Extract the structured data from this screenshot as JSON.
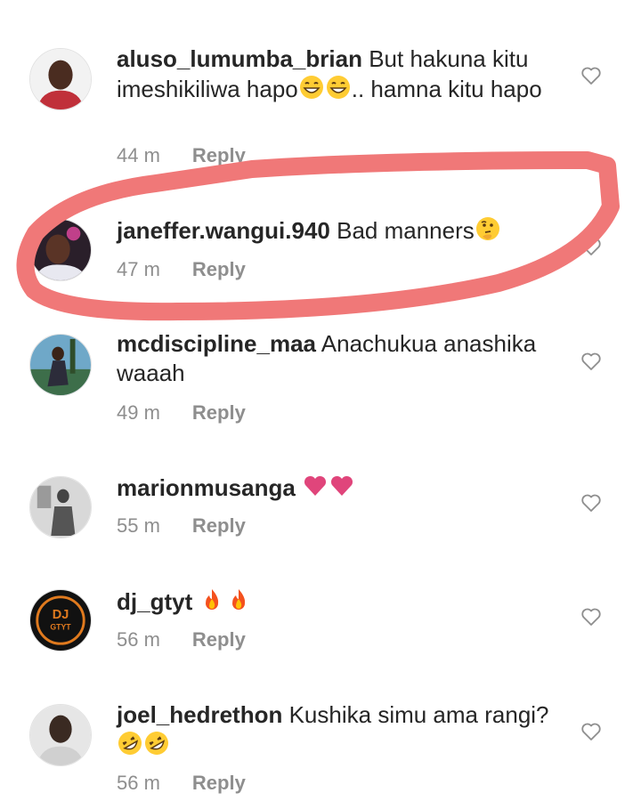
{
  "comments": [
    {
      "username": "aluso_lumumba_brian",
      "text_before": "But hakuna kitu imeshikiliwa hapo",
      "text_after": ".. hamna kitu hapo",
      "emojis": [
        "grinning-face-with-smiling-eyes",
        "grinning-face-with-smiling-eyes"
      ],
      "time": "44 m",
      "reply": "Reply"
    },
    {
      "username": "janeffer.wangui.940",
      "text": "Bad manners",
      "emojis": [
        "thinking-face"
      ],
      "time": "47 m",
      "reply": "Reply"
    },
    {
      "username": "mcdiscipline_maa",
      "text": "Anachukua anashika waaah",
      "time": "49 m",
      "reply": "Reply"
    },
    {
      "username": "marionmusanga",
      "text": "",
      "emojis": [
        "heart-suit",
        "heart-suit"
      ],
      "time": "55 m",
      "reply": "Reply"
    },
    {
      "username": "dj_gtyt",
      "text": "",
      "emojis": [
        "fire",
        "fire"
      ],
      "time": "56 m",
      "reply": "Reply"
    },
    {
      "username": "joel_hedrethon",
      "text": "Kushika simu ama rangi?",
      "emojis": [
        "rolling-on-floor-laughing",
        "rolling-on-floor-laughing"
      ],
      "time": "56 m",
      "reply": "Reply"
    }
  ],
  "dj_logo": {
    "top": "DJ",
    "bottom": "GTYT"
  },
  "colors": {
    "highlight": "#f07878",
    "username": "#262626",
    "meta": "#8e8e8e",
    "heart_emoji": "#e0457b",
    "fire_emoji": "#f4511e"
  },
  "icons": {
    "like": "heart-outline-icon"
  }
}
